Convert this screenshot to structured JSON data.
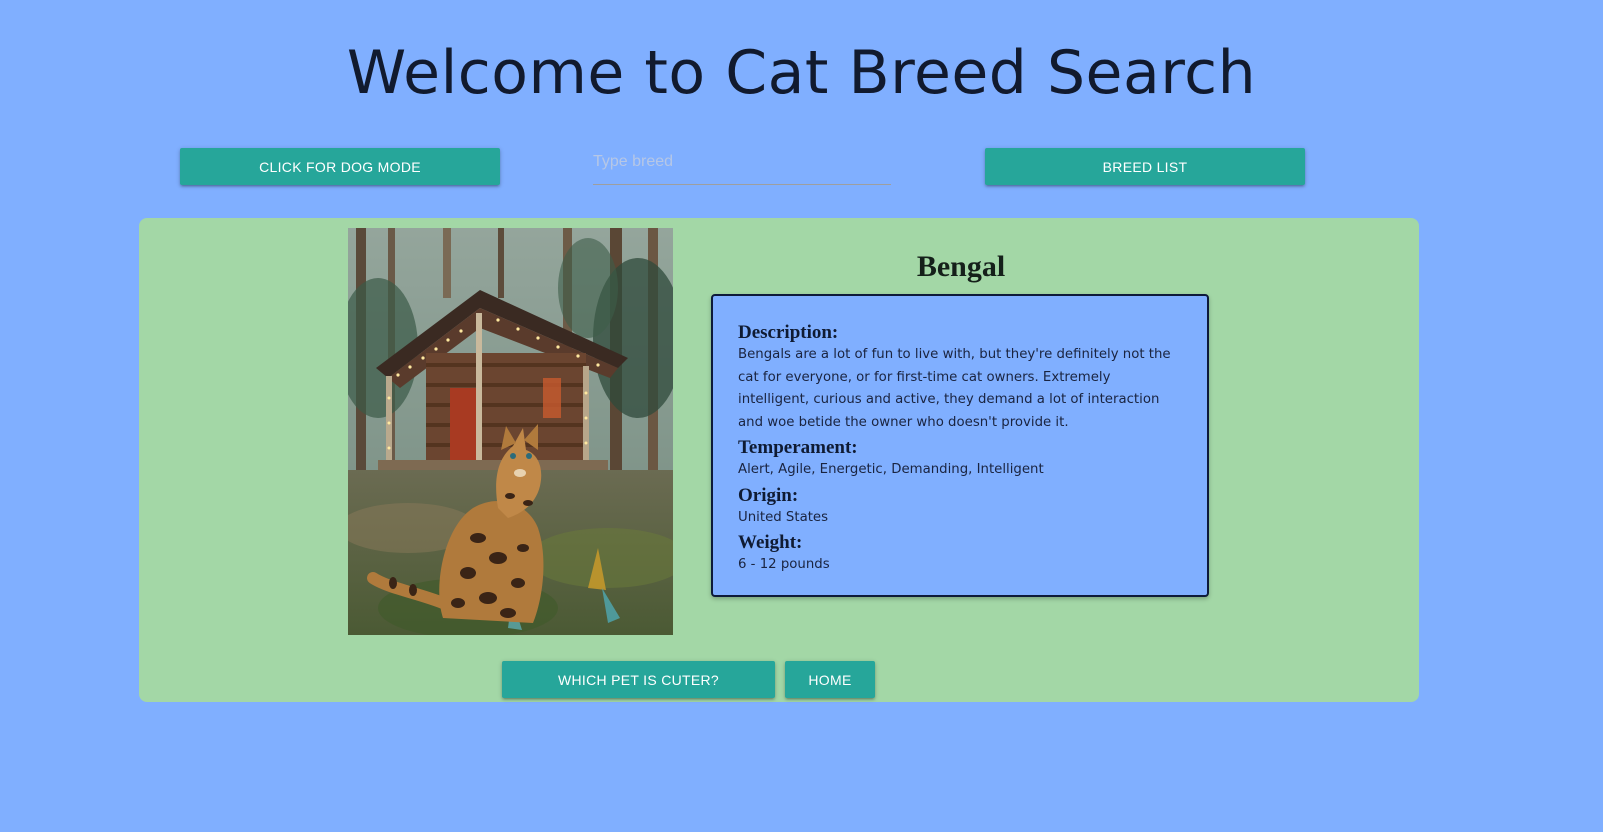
{
  "header": {
    "title": "Welcome to Cat Breed Search"
  },
  "toolbar": {
    "dog_mode_label": "CLICK FOR DOG MODE",
    "search_placeholder": "Type breed",
    "search_value": "",
    "breed_list_label": "BREED LIST"
  },
  "breed": {
    "name": "Bengal",
    "description_label": "Description:",
    "description": "Bengals are a lot of fun to live with, but they're definitely not the cat for everyone, or for first-time cat owners. Extremely intelligent, curious and active, they demand a lot of interaction and woe betide the owner who doesn't provide it.",
    "temperament_label": "Temperament:",
    "temperament": "Alert, Agile, Energetic, Demanding, Intelligent",
    "origin_label": "Origin:",
    "origin": "United States",
    "weight_label": "Weight:",
    "weight": "6 - 12 pounds"
  },
  "actions": {
    "cuter_label": "WHICH PET IS CUTER?",
    "home_label": "HOME"
  },
  "colors": {
    "background": "#80afff",
    "card": "#a3d7a6",
    "button": "#26a69a",
    "info_box": "#80afff"
  }
}
